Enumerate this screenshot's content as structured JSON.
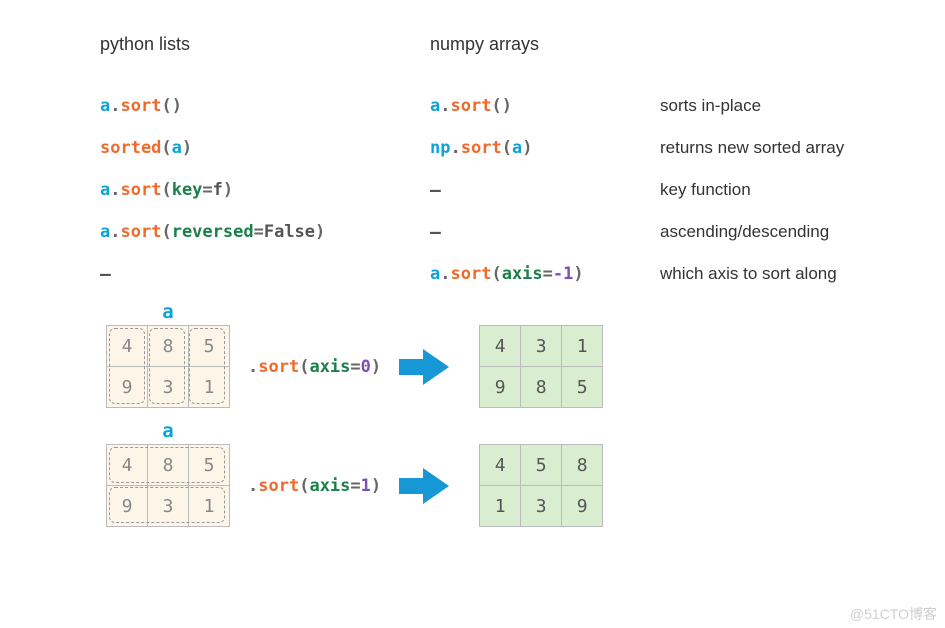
{
  "headings": {
    "col1": "python lists",
    "col2": "numpy arrays",
    "col3": ""
  },
  "rows": [
    {
      "py": [
        [
          "a",
          "c-a"
        ],
        [
          ".",
          "c-dot"
        ],
        [
          "sort",
          "c-fn"
        ],
        [
          "()",
          "c-par"
        ]
      ],
      "np": [
        [
          "a",
          "c-a"
        ],
        [
          ".",
          "c-dot"
        ],
        [
          "sort",
          "c-fn"
        ],
        [
          "()",
          "c-par"
        ]
      ],
      "desc": "sorts in-place"
    },
    {
      "py": [
        [
          "sorted",
          "c-fn"
        ],
        [
          "(",
          "c-par"
        ],
        [
          "a",
          "c-a"
        ],
        [
          ")",
          "c-par"
        ]
      ],
      "np": [
        [
          "np",
          "c-a"
        ],
        [
          ".",
          "c-dot"
        ],
        [
          "sort",
          "c-fn"
        ],
        [
          "(",
          "c-par"
        ],
        [
          "a",
          "c-a"
        ],
        [
          ")",
          "c-par"
        ]
      ],
      "desc": "returns new sorted array"
    },
    {
      "py": [
        [
          "a",
          "c-a"
        ],
        [
          ".",
          "c-dot"
        ],
        [
          "sort",
          "c-fn"
        ],
        [
          "(",
          "c-par"
        ],
        [
          "key",
          "c-kw"
        ],
        [
          "=",
          "c-eq"
        ],
        [
          "f",
          "c-val"
        ],
        [
          ")",
          "c-par"
        ]
      ],
      "np": [
        [
          "–",
          "c-dash"
        ]
      ],
      "desc": "key function"
    },
    {
      "py": [
        [
          "a",
          "c-a"
        ],
        [
          ".",
          "c-dot"
        ],
        [
          "sort",
          "c-fn"
        ],
        [
          "(",
          "c-par"
        ],
        [
          "reversed",
          "c-kw"
        ],
        [
          "=",
          "c-eq"
        ],
        [
          "False",
          "c-val"
        ],
        [
          ")",
          "c-par"
        ]
      ],
      "np": [
        [
          "–",
          "c-dash"
        ]
      ],
      "desc": "ascending/descending"
    },
    {
      "py": [
        [
          "–",
          "c-dash"
        ]
      ],
      "np": [
        [
          "a",
          "c-a"
        ],
        [
          ".",
          "c-dot"
        ],
        [
          "sort",
          "c-fn"
        ],
        [
          "(",
          "c-par"
        ],
        [
          "axis",
          "c-kw"
        ],
        [
          "=",
          "c-eq"
        ],
        [
          "-1",
          "c-num"
        ],
        [
          ")",
          "c-par"
        ]
      ],
      "desc": "which axis to sort along"
    }
  ],
  "diagram": {
    "a_label": "a",
    "input": [
      [
        4,
        8,
        5
      ],
      [
        9,
        3,
        1
      ]
    ],
    "axis0": {
      "call": [
        [
          ".",
          "c-dot"
        ],
        [
          "sort",
          "c-fn"
        ],
        [
          "(",
          "c-par"
        ],
        [
          "axis",
          "c-kw"
        ],
        [
          "=",
          "c-eq"
        ],
        [
          "0",
          "c-num"
        ],
        [
          ")",
          "c-par"
        ]
      ],
      "output": [
        [
          4,
          3,
          1
        ],
        [
          9,
          8,
          5
        ]
      ],
      "selection": "columns"
    },
    "axis1": {
      "call": [
        [
          ".",
          "c-dot"
        ],
        [
          "sort",
          "c-fn"
        ],
        [
          "(",
          "c-par"
        ],
        [
          "axis",
          "c-kw"
        ],
        [
          "=",
          "c-eq"
        ],
        [
          "1",
          "c-num"
        ],
        [
          ")",
          "c-par"
        ]
      ],
      "output": [
        [
          4,
          5,
          8
        ],
        [
          1,
          3,
          9
        ]
      ],
      "selection": "rows"
    }
  },
  "watermark": "@51CTO博客",
  "chart_data": {
    "type": "table",
    "input_matrix": [
      [
        4,
        8,
        5
      ],
      [
        9,
        3,
        1
      ]
    ],
    "sort_axis0_output": [
      [
        4,
        3,
        1
      ],
      [
        9,
        8,
        5
      ]
    ],
    "sort_axis1_output": [
      [
        4,
        5,
        8
      ],
      [
        1,
        3,
        9
      ]
    ]
  }
}
